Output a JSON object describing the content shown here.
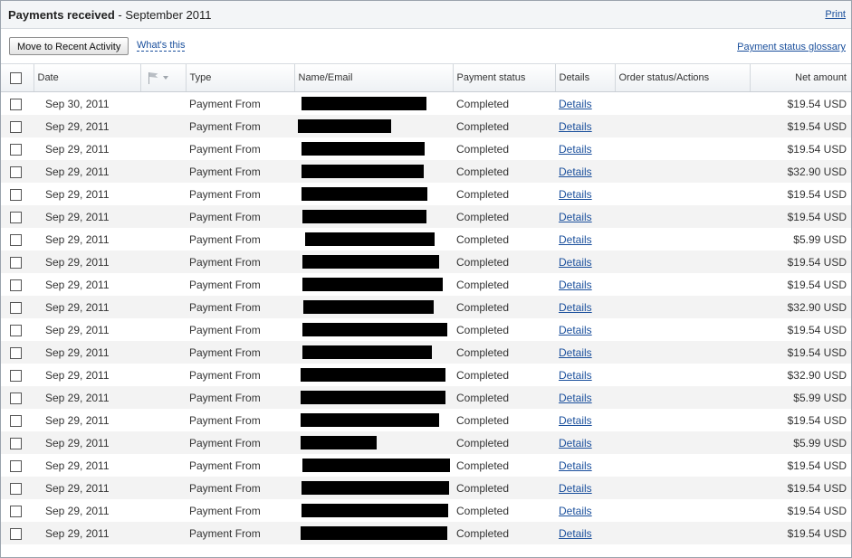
{
  "header": {
    "title_bold": "Payments received",
    "title_rest": " - September 2011",
    "print_label": "Print"
  },
  "toolbar": {
    "move_label": "Move to Recent Activity",
    "whats_this_label": "What's this",
    "glossary_label": "Payment status glossary"
  },
  "table": {
    "columns": {
      "date": "Date",
      "flag_icon": "flag-dropdown-icon",
      "type": "Type",
      "name": "Name/Email",
      "status": "Payment status",
      "details": "Details",
      "order": "Order status/Actions",
      "net": "Net amount"
    },
    "rows": [
      {
        "date": "Sep 30, 2011",
        "type": "Payment From",
        "status": "Completed",
        "details": "Details",
        "net": "$19.54 USD"
      },
      {
        "date": "Sep 29, 2011",
        "type": "Payment From",
        "status": "Completed",
        "details": "Details",
        "net": "$19.54 USD"
      },
      {
        "date": "Sep 29, 2011",
        "type": "Payment From",
        "status": "Completed",
        "details": "Details",
        "net": "$19.54 USD"
      },
      {
        "date": "Sep 29, 2011",
        "type": "Payment From",
        "status": "Completed",
        "details": "Details",
        "net": "$32.90 USD"
      },
      {
        "date": "Sep 29, 2011",
        "type": "Payment From",
        "status": "Completed",
        "details": "Details",
        "net": "$19.54 USD"
      },
      {
        "date": "Sep 29, 2011",
        "type": "Payment From",
        "status": "Completed",
        "details": "Details",
        "net": "$19.54 USD"
      },
      {
        "date": "Sep 29, 2011",
        "type": "Payment From",
        "status": "Completed",
        "details": "Details",
        "net": "$5.99 USD"
      },
      {
        "date": "Sep 29, 2011",
        "type": "Payment From",
        "status": "Completed",
        "details": "Details",
        "net": "$19.54 USD"
      },
      {
        "date": "Sep 29, 2011",
        "type": "Payment From",
        "status": "Completed",
        "details": "Details",
        "net": "$19.54 USD"
      },
      {
        "date": "Sep 29, 2011",
        "type": "Payment From",
        "status": "Completed",
        "details": "Details",
        "net": "$32.90 USD"
      },
      {
        "date": "Sep 29, 2011",
        "type": "Payment From",
        "status": "Completed",
        "details": "Details",
        "net": "$19.54 USD"
      },
      {
        "date": "Sep 29, 2011",
        "type": "Payment From",
        "status": "Completed",
        "details": "Details",
        "net": "$19.54 USD"
      },
      {
        "date": "Sep 29, 2011",
        "type": "Payment From",
        "status": "Completed",
        "details": "Details",
        "net": "$32.90 USD"
      },
      {
        "date": "Sep 29, 2011",
        "type": "Payment From",
        "status": "Completed",
        "details": "Details",
        "net": "$5.99 USD"
      },
      {
        "date": "Sep 29, 2011",
        "type": "Payment From",
        "status": "Completed",
        "details": "Details",
        "net": "$19.54 USD"
      },
      {
        "date": "Sep 29, 2011",
        "type": "Payment From",
        "status": "Completed",
        "details": "Details",
        "net": "$5.99 USD"
      },
      {
        "date": "Sep 29, 2011",
        "type": "Payment From",
        "status": "Completed",
        "details": "Details",
        "net": "$19.54 USD"
      },
      {
        "date": "Sep 29, 2011",
        "type": "Payment From",
        "status": "Completed",
        "details": "Details",
        "net": "$19.54 USD"
      },
      {
        "date": "Sep 29, 2011",
        "type": "Payment From",
        "status": "Completed",
        "details": "Details",
        "net": "$19.54 USD"
      },
      {
        "date": "Sep 29, 2011",
        "type": "Payment From",
        "status": "Completed",
        "details": "Details",
        "net": "$19.54 USD"
      }
    ]
  }
}
